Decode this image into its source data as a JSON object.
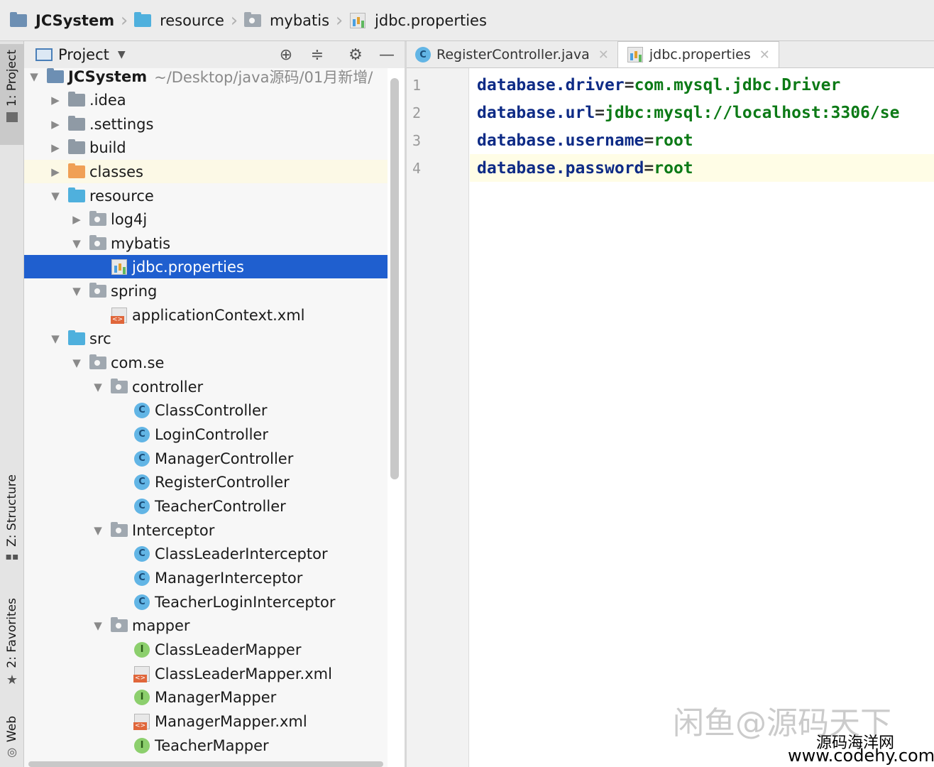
{
  "breadcrumbs": [
    {
      "label": "JCSystem",
      "icon": "module-icon"
    },
    {
      "label": "resource",
      "icon": "folder-icon"
    },
    {
      "label": "mybatis",
      "icon": "folder-icon"
    },
    {
      "label": "jdbc.properties",
      "icon": "properties-file-icon"
    }
  ],
  "toolstrip": {
    "project_tab": "1: Project",
    "structure_tab": "Z: Structure",
    "favorites_tab": "2: Favorites",
    "web_tab": "Web"
  },
  "project_panel": {
    "title": "Project",
    "root": {
      "name": "JCSystem",
      "path": "~/Desktop/java源码/01月新增/"
    },
    "items": [
      {
        "label": ".idea"
      },
      {
        "label": ".settings"
      },
      {
        "label": "build"
      },
      {
        "label": "classes"
      },
      {
        "label": "resource"
      },
      {
        "label": "log4j"
      },
      {
        "label": "mybatis"
      },
      {
        "label": "jdbc.properties"
      },
      {
        "label": "spring"
      },
      {
        "label": "applicationContext.xml"
      },
      {
        "label": "src"
      },
      {
        "label": "com.se"
      },
      {
        "label": "controller"
      },
      {
        "label": "ClassController"
      },
      {
        "label": "LoginController"
      },
      {
        "label": "ManagerController"
      },
      {
        "label": "RegisterController"
      },
      {
        "label": "TeacherController"
      },
      {
        "label": "Interceptor"
      },
      {
        "label": "ClassLeaderInterceptor"
      },
      {
        "label": "ManagerInterceptor"
      },
      {
        "label": "TeacherLoginInterceptor"
      },
      {
        "label": "mapper"
      },
      {
        "label": "ClassLeaderMapper"
      },
      {
        "label": "ClassLeaderMapper.xml"
      },
      {
        "label": "ManagerMapper"
      },
      {
        "label": "ManagerMapper.xml"
      },
      {
        "label": "TeacherMapper"
      }
    ]
  },
  "editor": {
    "tabs": [
      {
        "label": "RegisterController.java"
      },
      {
        "label": "jdbc.properties"
      }
    ],
    "line_numbers": [
      "1",
      "2",
      "3",
      "4"
    ],
    "lines": [
      {
        "key": "database.driver",
        "value": "com.mysql.jdbc.Driver"
      },
      {
        "key": "database.url",
        "value": "jdbc:mysql://localhost:3306/se"
      },
      {
        "key": "database.username",
        "value": "root"
      },
      {
        "key": "database.password",
        "value": "root"
      }
    ]
  },
  "overlay": {
    "watermark": "闲鱼@源码天下",
    "site_name": "源码海洋网",
    "site_url": "www.codehy.com"
  },
  "colors": {
    "selection": "#1f5fcf",
    "key": "#0e2b86",
    "value": "#0c7a16",
    "current_line": "#fffde6"
  }
}
